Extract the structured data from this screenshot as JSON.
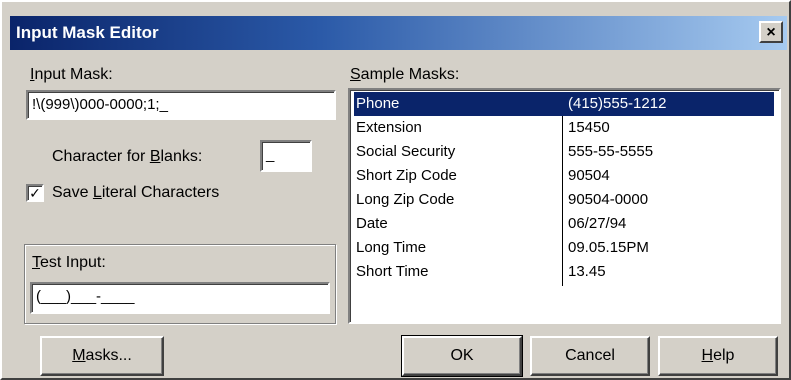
{
  "window": {
    "title": "Input Mask Editor",
    "close_glyph": "×"
  },
  "input_mask": {
    "label_pre": "",
    "label_ul": "I",
    "label_post": "nput Mask:",
    "value": "!\\(999\\)000-0000;1;_"
  },
  "blanks": {
    "label_pre": "Character for ",
    "label_ul": "B",
    "label_post": "lanks:",
    "value": "_"
  },
  "save_literal": {
    "checked": true,
    "check_glyph": "✓",
    "label_pre": "Save ",
    "label_ul": "L",
    "label_post": "iteral Characters"
  },
  "test_input": {
    "label_pre": "",
    "label_ul": "T",
    "label_post": "est Input:",
    "value": "(___)___-____"
  },
  "sample_masks": {
    "label_pre": "",
    "label_ul": "S",
    "label_post": "ample Masks:",
    "rows": [
      {
        "name": "Phone",
        "sample": "(415)555-1212",
        "selected": true
      },
      {
        "name": "Extension",
        "sample": "15450",
        "selected": false
      },
      {
        "name": "Social Security",
        "sample": "555-55-5555",
        "selected": false
      },
      {
        "name": "Short Zip Code",
        "sample": "90504",
        "selected": false
      },
      {
        "name": "Long Zip Code",
        "sample": "90504-0000",
        "selected": false
      },
      {
        "name": "Date",
        "sample": "06/27/94",
        "selected": false
      },
      {
        "name": "Long Time",
        "sample": "09.05.15PM",
        "selected": false
      },
      {
        "name": "Short Time",
        "sample": "13.45",
        "selected": false
      }
    ]
  },
  "buttons": {
    "masks": {
      "pre": "",
      "ul": "M",
      "post": "asks..."
    },
    "ok": {
      "label": "OK"
    },
    "cancel": {
      "label": "Cancel"
    },
    "help": {
      "pre": "",
      "ul": "H",
      "post": "elp"
    }
  }
}
